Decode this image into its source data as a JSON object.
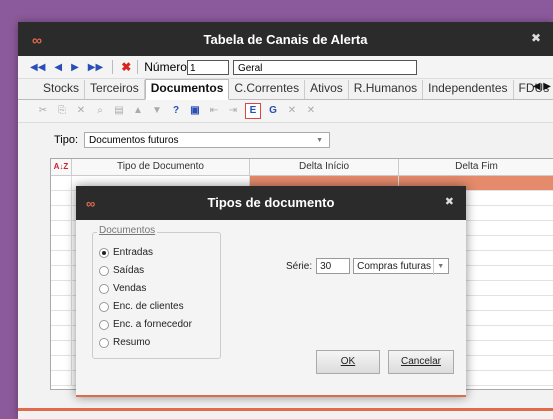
{
  "window": {
    "title": "Tabela de Canais de Alerta",
    "logo": "∞",
    "close": "✖"
  },
  "toolbar": {
    "numero_label": "Número",
    "numero_value": "1",
    "name_value": "Geral"
  },
  "tabs": [
    "Stocks",
    "Terceiros",
    "Documentos",
    "C.Correntes",
    "Ativos",
    "R.Humanos",
    "Independentes",
    "FDUs"
  ],
  "tipo": {
    "label": "Tipo:",
    "value": "Documentos futuros"
  },
  "grid": {
    "sort_icon": "A↓Z",
    "headers": [
      "Tipo de Documento",
      "Delta Início",
      "Delta Fim"
    ]
  },
  "dialog": {
    "title": "Tipos de documento",
    "logo": "∞",
    "close": "✖",
    "group_label": "Documentos",
    "options": [
      "Entradas",
      "Saídas",
      "Vendas",
      "Enc. de clientes",
      "Enc. a fornecedor",
      "Resumo"
    ],
    "selected_index": 0,
    "serie_label": "Série:",
    "serie_value": "30",
    "serie_select": "Compras futuras",
    "ok_label": "OK",
    "cancel_label": "Cancelar"
  },
  "colors": {
    "accent": "#e06a4a",
    "titlebar": "#2b2b2b",
    "background": "#8b5a9c"
  }
}
